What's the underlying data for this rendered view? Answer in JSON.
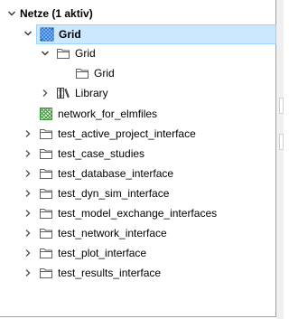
{
  "tree": {
    "root": {
      "label": "Netze (1 aktiv)",
      "expanded": true,
      "icon": "none"
    },
    "items": [
      {
        "label": "Grid",
        "icon": "grid-network-blue-icon",
        "expanded": true,
        "selected": true,
        "bold": true
      },
      {
        "label": "Grid",
        "icon": "folder-icon",
        "expanded": true
      },
      {
        "label": "Grid",
        "icon": "folder-icon",
        "expanded": false,
        "leaf": true
      },
      {
        "label": "Library",
        "icon": "library-icon",
        "expanded": false
      },
      {
        "label": "network_for_elmfiles",
        "icon": "grid-network-green-icon",
        "leaf": true
      },
      {
        "label": "test_active_project_interface",
        "icon": "folder-icon",
        "expanded": false
      },
      {
        "label": "test_case_studies",
        "icon": "folder-icon",
        "expanded": false
      },
      {
        "label": "test_database_interface",
        "icon": "folder-icon",
        "expanded": false
      },
      {
        "label": "test_dyn_sim_interface",
        "icon": "folder-icon",
        "expanded": false
      },
      {
        "label": "test_model_exchange_interfaces",
        "icon": "folder-icon",
        "expanded": false
      },
      {
        "label": "test_network_interface",
        "icon": "folder-icon",
        "expanded": false
      },
      {
        "label": "test_plot_interface",
        "icon": "folder-icon",
        "expanded": false
      },
      {
        "label": "test_results_interface",
        "icon": "folder-icon",
        "expanded": false
      }
    ]
  },
  "colors": {
    "selection_bg": "#cce8ff",
    "selection_border": "#99d1ff",
    "chevron": "#555555",
    "grid_blue": "#1f6fd1",
    "grid_green": "#3a9a3a",
    "folder_stroke": "#606060"
  }
}
